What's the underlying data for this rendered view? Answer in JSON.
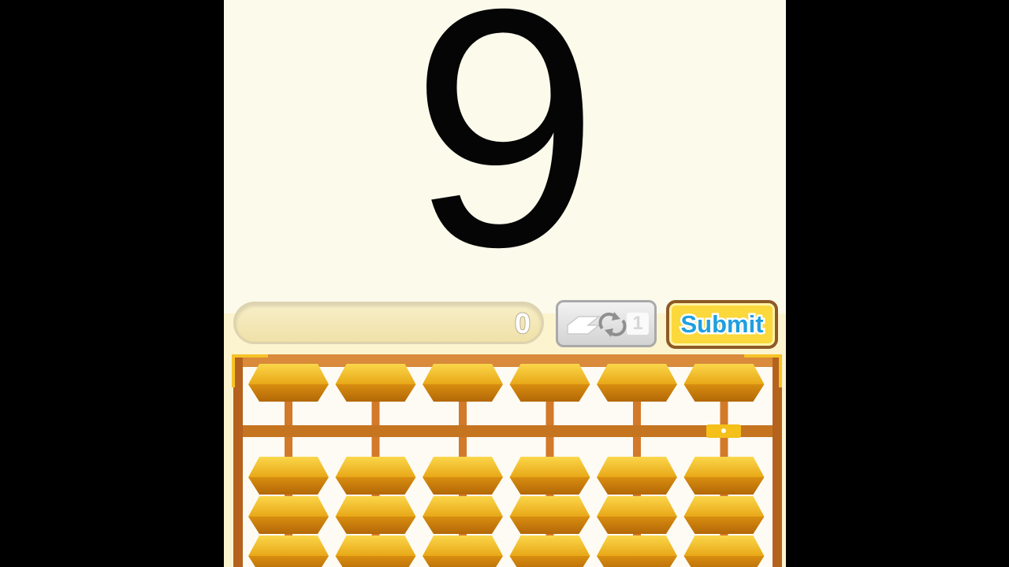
{
  "target": {
    "number": "9"
  },
  "answer": {
    "value": "0"
  },
  "controls": {
    "reset_count": "1",
    "submit_label": "Submit"
  },
  "abacus": {
    "rods": 6,
    "heaven_beads_per_rod": 1,
    "earth_beads_visible_per_rod": 3,
    "marker": "unit-rod-dot"
  },
  "colors": {
    "background": "#fbfaeb",
    "bead_light": "#f4c52a",
    "bead_dark": "#c97e0c",
    "frame": "#c96d22",
    "submit_text": "#1f9fe0"
  }
}
